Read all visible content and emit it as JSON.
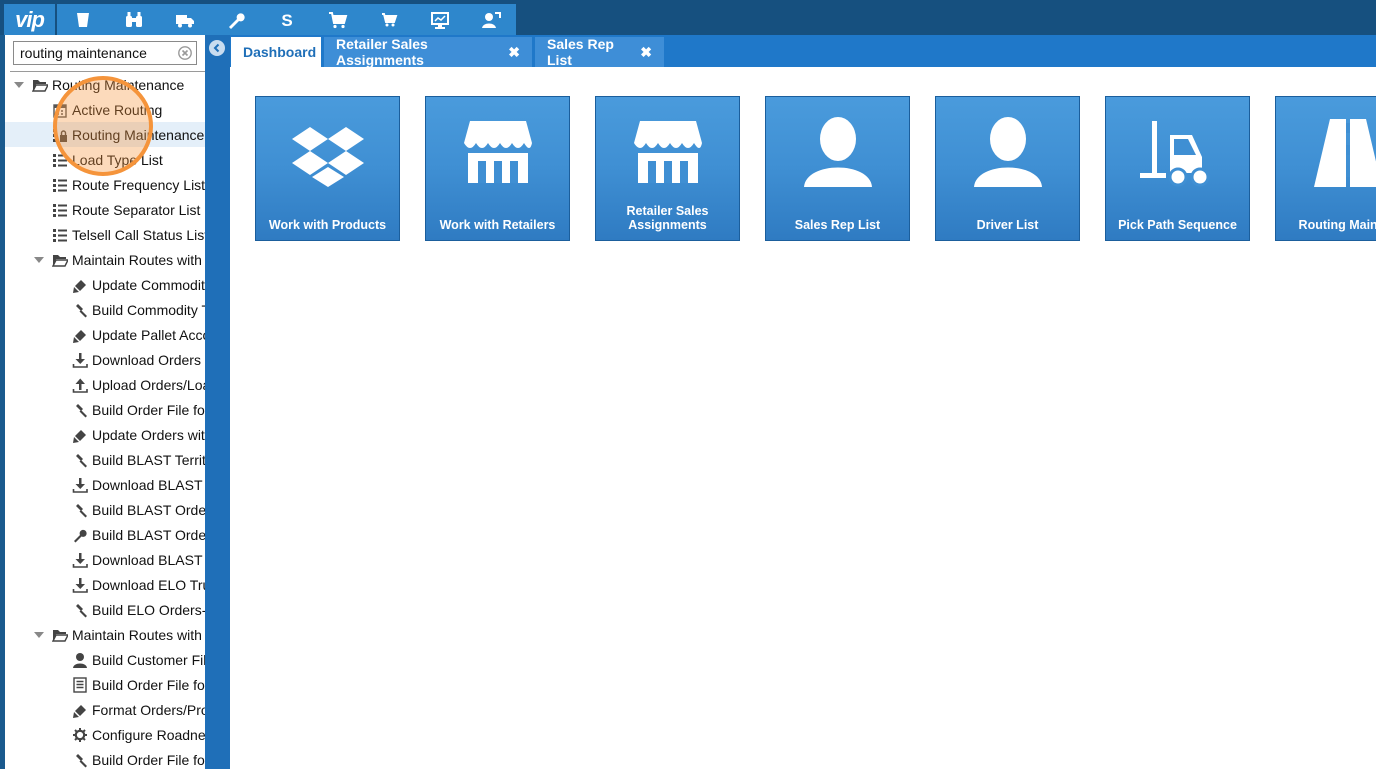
{
  "topnav": {
    "logo": "vip",
    "buttons": [
      "cup-icon",
      "binoculars-icon",
      "truck-icon",
      "wrench-icon",
      "dollar-icon",
      "cart-icon",
      "cart-small-icon",
      "monitor-icon",
      "user-share-icon"
    ]
  },
  "search": {
    "value": "routing maintenance"
  },
  "tree": [
    {
      "label": "Routing Maintenance",
      "icon": "folder-open-icon",
      "level": 0,
      "expander": true
    },
    {
      "label": "Active Routing",
      "icon": "calendar-icon",
      "level": 1
    },
    {
      "label": "Routing Maintenance",
      "icon": "list-lock-icon",
      "level": 1,
      "selected": true
    },
    {
      "label": "Load Type List",
      "icon": "list-icon",
      "level": 1
    },
    {
      "label": "Route Frequency List",
      "icon": "list-icon",
      "level": 1
    },
    {
      "label": "Route Separator List",
      "icon": "list-icon",
      "level": 1
    },
    {
      "label": "Telsell Call Status List",
      "icon": "list-icon",
      "level": 1
    },
    {
      "label": "Maintain Routes with R",
      "icon": "folder-open-icon",
      "level": 1,
      "expander": true
    },
    {
      "label": "Update Commodity",
      "icon": "pencil-icon",
      "level": 2
    },
    {
      "label": "Build Commodity Ty",
      "icon": "hammer-icon",
      "level": 2
    },
    {
      "label": "Update Pallet Accou",
      "icon": "pencil-icon",
      "level": 2
    },
    {
      "label": "Download Orders to",
      "icon": "download-icon",
      "level": 2
    },
    {
      "label": "Upload Orders/Load",
      "icon": "upload-icon",
      "level": 2
    },
    {
      "label": "Build Order File for",
      "icon": "hammer-icon",
      "level": 2
    },
    {
      "label": "Update Orders with",
      "icon": "pencil-icon",
      "level": 2
    },
    {
      "label": "Build BLAST Territo",
      "icon": "hammer-icon",
      "level": 2
    },
    {
      "label": "Download BLAST F",
      "icon": "download-icon",
      "level": 2
    },
    {
      "label": "Build BLAST Orders",
      "icon": "hammer-icon",
      "level": 2
    },
    {
      "label": "Build BLAST Orders",
      "icon": "wrench-icon",
      "level": 2
    },
    {
      "label": "Download BLAST T",
      "icon": "download-icon",
      "level": 2
    },
    {
      "label": "Download ELO Truc",
      "icon": "download-icon",
      "level": 2
    },
    {
      "label": "Build ELO Orders-b",
      "icon": "hammer-icon",
      "level": 2
    },
    {
      "label": "Maintain Routes with R",
      "icon": "folder-open-icon",
      "level": 1,
      "expander": true
    },
    {
      "label": "Build Customer File",
      "icon": "user-icon",
      "level": 2
    },
    {
      "label": "Build Order File for",
      "icon": "document-icon",
      "level": 2
    },
    {
      "label": "Format Orders/Prod",
      "icon": "pencil-icon",
      "level": 2
    },
    {
      "label": "Configure Roadnet",
      "icon": "gear-icon",
      "level": 2
    },
    {
      "label": "Build Order File for",
      "icon": "hammer-icon",
      "level": 2
    }
  ],
  "tabs": [
    {
      "label": "Dashboard",
      "active": true,
      "closable": false
    },
    {
      "label": "Retailer Sales Assignments",
      "active": false,
      "closable": true
    },
    {
      "label": "Sales Rep List",
      "active": false,
      "closable": true
    }
  ],
  "tab_close_glyph": "✖",
  "tiles": [
    {
      "label": "Work with Products",
      "icon": "dropbox-icon"
    },
    {
      "label": "Work with Retailers",
      "icon": "storefront-icon"
    },
    {
      "label": "Retailer Sales\nAssignments",
      "icon": "storefront-icon"
    },
    {
      "label": "Sales Rep List",
      "icon": "user-icon"
    },
    {
      "label": "Driver List",
      "icon": "user-icon"
    },
    {
      "label": "Pick Path Sequence",
      "icon": "forklift-icon"
    },
    {
      "label": "Routing Mainten",
      "icon": "road-icon"
    }
  ],
  "colors": {
    "accent": "#1f78c9",
    "dark": "#16507f",
    "tile": "#3f8fd3",
    "highlight": "#f5943b"
  }
}
